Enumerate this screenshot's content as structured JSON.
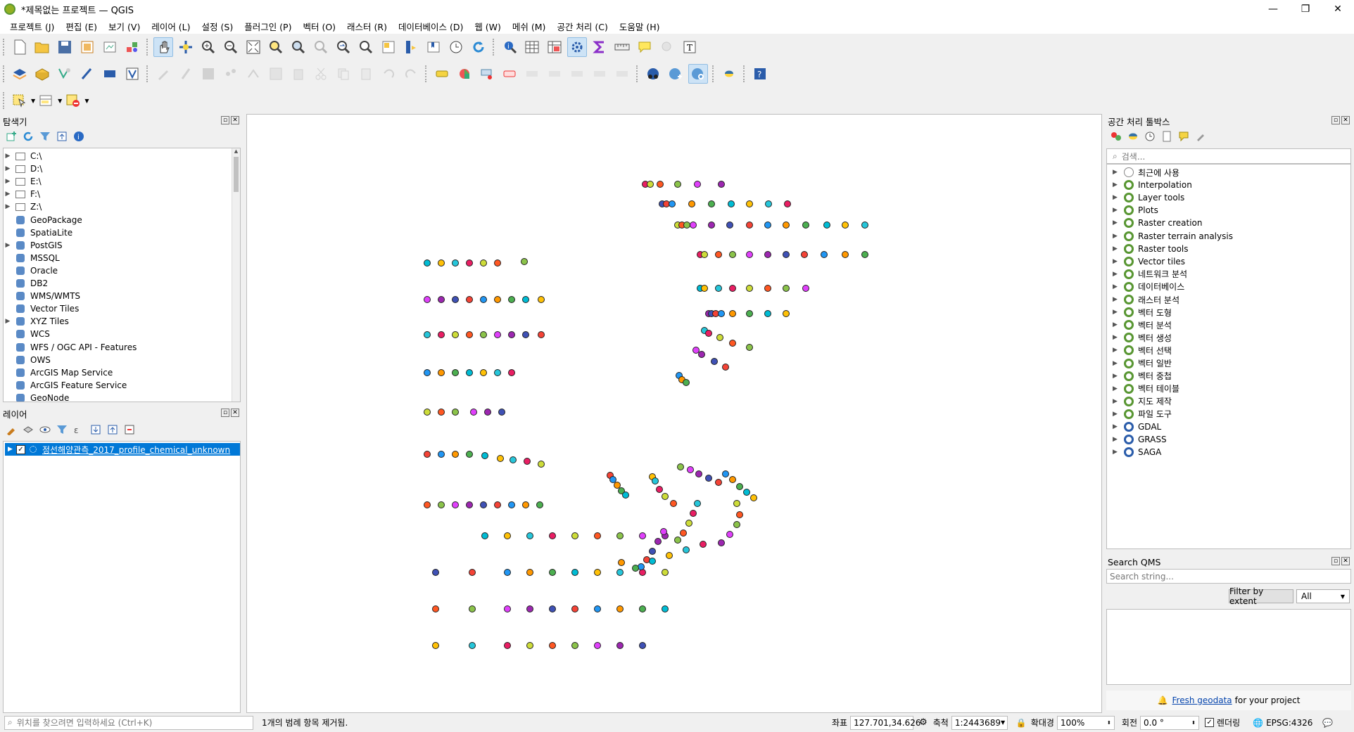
{
  "window": {
    "title": "*제목없는 프로젝트 — QGIS",
    "minimize": "—",
    "maximize": "❐",
    "close": "✕"
  },
  "menu": [
    "프로젝트 (J)",
    "편집 (E)",
    "보기 (V)",
    "레이어 (L)",
    "설정 (S)",
    "플러그인 (P)",
    "벡터 (O)",
    "래스터 (R)",
    "데이터베이스 (D)",
    "웹 (W)",
    "메쉬 (M)",
    "공간 처리 (C)",
    "도움말 (H)"
  ],
  "browser": {
    "title": "탐색기",
    "items": [
      {
        "label": "C:\\",
        "expand": true,
        "icon": "folder-icon"
      },
      {
        "label": "D:\\",
        "expand": true,
        "icon": "folder-icon"
      },
      {
        "label": "E:\\",
        "expand": true,
        "icon": "folder-icon"
      },
      {
        "label": "F:\\",
        "expand": true,
        "icon": "folder-icon"
      },
      {
        "label": "Z:\\",
        "expand": true,
        "icon": "folder-icon"
      },
      {
        "label": "GeoPackage",
        "expand": false,
        "icon": "geopackage-icon"
      },
      {
        "label": "SpatiaLite",
        "expand": false,
        "icon": "spatialite-icon"
      },
      {
        "label": "PostGIS",
        "expand": true,
        "icon": "postgis-icon"
      },
      {
        "label": "MSSQL",
        "expand": false,
        "icon": "mssql-icon"
      },
      {
        "label": "Oracle",
        "expand": false,
        "icon": "oracle-icon"
      },
      {
        "label": "DB2",
        "expand": false,
        "icon": "db2-icon"
      },
      {
        "label": "WMS/WMTS",
        "expand": false,
        "icon": "wms-icon"
      },
      {
        "label": "Vector Tiles",
        "expand": false,
        "icon": "vector-tiles-icon"
      },
      {
        "label": "XYZ Tiles",
        "expand": true,
        "icon": "xyz-tiles-icon"
      },
      {
        "label": "WCS",
        "expand": false,
        "icon": "wcs-icon"
      },
      {
        "label": "WFS / OGC API - Features",
        "expand": false,
        "icon": "wfs-icon"
      },
      {
        "label": "OWS",
        "expand": false,
        "icon": "ows-icon"
      },
      {
        "label": "ArcGIS Map Service",
        "expand": false,
        "icon": "arcgis-map-icon"
      },
      {
        "label": "ArcGIS Feature Service",
        "expand": false,
        "icon": "arcgis-feature-icon"
      },
      {
        "label": "GeoNode",
        "expand": false,
        "icon": "geonode-icon"
      }
    ]
  },
  "layers": {
    "title": "레이어",
    "items": [
      {
        "label": "정선해양관측_2017_profile_chemical_unknown",
        "checked": "✓"
      }
    ]
  },
  "processing": {
    "title": "공간 처리 툴박스",
    "search_placeholder": "검색...",
    "items": [
      "최근에 사용",
      "Interpolation",
      "Layer tools",
      "Plots",
      "Raster creation",
      "Raster terrain analysis",
      "Raster tools",
      "Vector tiles",
      "네트워크 분석",
      "데이터베이스",
      "래스터 분석",
      "벡터 도형",
      "벡터 분석",
      "벡터 생성",
      "벡터 선택",
      "벡터 일반",
      "벡터 중첩",
      "벡터 테이블",
      "지도 제작",
      "파일 도구",
      "GDAL",
      "GRASS",
      "SAGA"
    ]
  },
  "qms": {
    "title": "Search QMS",
    "placeholder": "Search string...",
    "filter_button": "Filter by extent",
    "filter_value": "All",
    "fresh_link": "Fresh geodata",
    "fresh_suffix": "for your project"
  },
  "status": {
    "locator_placeholder": "위치를 찾으려면 입력하세요 (Ctrl+K)",
    "message": "1개의 범례 항목 제거됨.",
    "coord_label": "좌표",
    "coord_value": "127.701,34.626",
    "scale_label": "축척",
    "scale_value": "1:2443689",
    "magnifier_label": "확대경",
    "magnifier_value": "100%",
    "rotation_label": "회전",
    "rotation_value": "0.0 °",
    "render_label": "렌더링",
    "crs": "EPSG:4326"
  },
  "map_point_colors": [
    "#e91e63",
    "#9c27b0",
    "#4caf50",
    "#cddc39",
    "#3f51b5",
    "#00bcd4",
    "#ff5722",
    "#f44336",
    "#ffc107",
    "#8bc34a",
    "#2196f3",
    "#26c6da",
    "#e040fb",
    "#ff9800"
  ]
}
